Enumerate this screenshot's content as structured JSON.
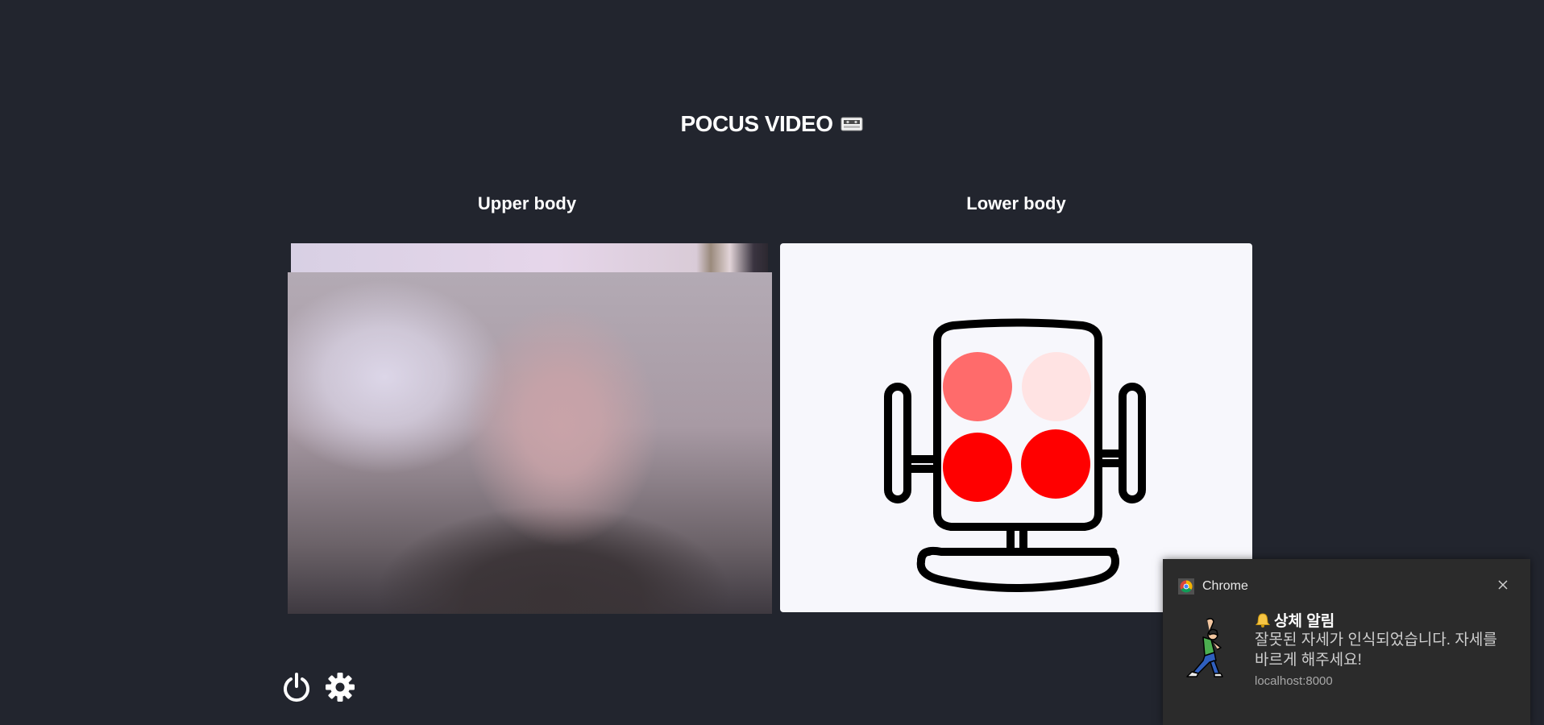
{
  "app": {
    "title": "POCUS VIDEO",
    "title_icon": "video-tape-icon"
  },
  "panels": {
    "upper_label": "Upper body",
    "lower_label": "Lower body"
  },
  "posture_sensor": {
    "icon": "seat-pressure-sensor-icon",
    "zones": [
      {
        "name": "top-left",
        "color": "#ff6b6b"
      },
      {
        "name": "top-right",
        "color": "#ffe3e3"
      },
      {
        "name": "bottom-left",
        "color": "#ff0000"
      },
      {
        "name": "bottom-right",
        "color": "#ff0000"
      }
    ]
  },
  "controls": {
    "power_icon": "power-icon",
    "settings_icon": "gear-icon"
  },
  "notification": {
    "app_name": "Chrome",
    "app_icon": "chrome-icon",
    "title_emoji": "bell-icon",
    "title": "상체 알림",
    "body": "잘못된 자세가 인식되었습니다. 자세를 바르게 해주세요!",
    "source": "localhost:8000",
    "image_icon": "stretching-person-icon"
  },
  "colors": {
    "background": "#22252e",
    "panel_bg": "#f7f7fc",
    "alert_red": "#ff0000",
    "alert_light": "#ff6b6b",
    "alert_faint": "#ffe3e3"
  }
}
